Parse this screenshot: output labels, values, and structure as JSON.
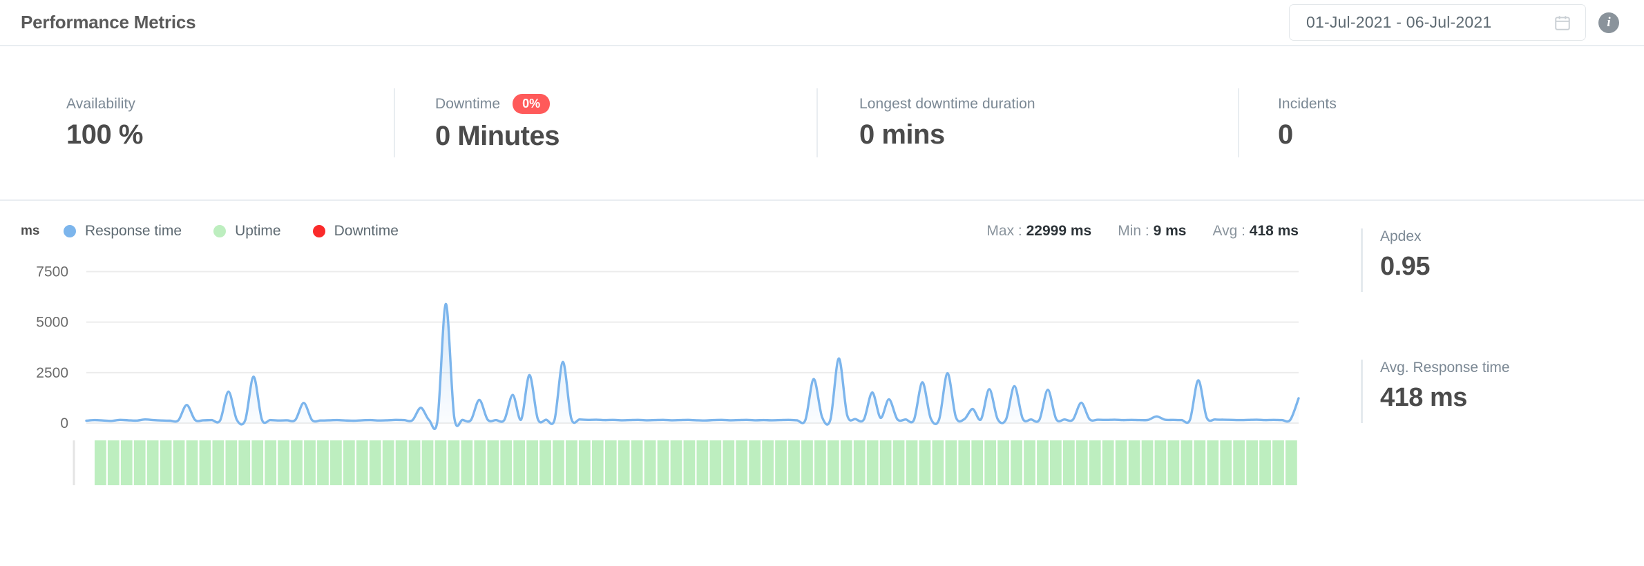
{
  "header": {
    "title": "Performance Metrics",
    "date_range": "01-Jul-2021  -  06-Jul-2021",
    "calendar_icon": "calendar-icon",
    "info_icon": "info-icon"
  },
  "kpis": [
    {
      "label": "Availability",
      "value": "100 %",
      "badge": null
    },
    {
      "label": "Downtime",
      "value": "0 Minutes",
      "badge": "0%",
      "badge_color": "#ff5a5a"
    },
    {
      "label": "Longest downtime duration",
      "value": "0 mins",
      "badge": null
    },
    {
      "label": "Incidents",
      "value": "0",
      "badge": null
    }
  ],
  "chart_header": {
    "unit": "ms",
    "legend": [
      {
        "label": "Response time",
        "color": "#7cb5ec"
      },
      {
        "label": "Uptime",
        "color": "#bdeebf"
      },
      {
        "label": "Downtime",
        "color": "#fa2a2a"
      }
    ],
    "stats": [
      {
        "label": "Max :",
        "value": "22999 ms"
      },
      {
        "label": "Min :",
        "value": "9 ms"
      },
      {
        "label": "Avg :",
        "value": "418 ms"
      }
    ]
  },
  "side_panel": [
    {
      "label": "Apdex",
      "value": "0.95"
    },
    {
      "label": "Avg. Response time",
      "value": "418 ms"
    }
  ],
  "chart_data": {
    "type": "area",
    "title": "",
    "xlabel": "",
    "ylabel": "ms",
    "ylim": [
      0,
      8200
    ],
    "yticks": [
      0,
      2500,
      5000,
      7500
    ],
    "ytick_labels": [
      "0",
      "2500",
      "5000",
      "7500"
    ],
    "grid": true,
    "legend_position": "top-left",
    "series": [
      {
        "name": "Response time",
        "color": "#7cb5ec",
        "fill": "rgba(124,181,236,0.18)",
        "values": [
          120,
          150,
          130,
          110,
          160,
          140,
          125,
          180,
          150,
          130,
          120,
          135,
          900,
          160,
          140,
          150,
          130,
          1560,
          160,
          140,
          2300,
          170,
          150,
          130,
          140,
          160,
          1000,
          150,
          130,
          140,
          150,
          130,
          120,
          140,
          150,
          130,
          140,
          160,
          150,
          140,
          760,
          150,
          140,
          5900,
          300,
          160,
          150,
          1150,
          170,
          150,
          160,
          1400,
          170,
          2380,
          200,
          170,
          160,
          3030,
          230,
          180,
          160,
          170,
          150,
          160,
          140,
          150,
          160,
          140,
          150,
          160,
          140,
          150,
          160,
          140,
          130,
          150,
          160,
          140,
          150,
          160,
          140,
          150,
          140,
          150,
          160,
          140,
          150,
          2180,
          300,
          180,
          3200,
          400,
          200,
          180,
          1520,
          260,
          1180,
          190,
          180,
          170,
          2020,
          230,
          180,
          2470,
          300,
          190,
          700,
          180,
          1680,
          200,
          180,
          1830,
          220,
          180,
          170,
          1650,
          200,
          180,
          170,
          1010,
          190,
          170,
          160,
          170,
          150,
          160,
          150,
          160,
          330,
          170,
          160,
          150,
          160,
          2120,
          280,
          180,
          170,
          160,
          150,
          160,
          170,
          150,
          160,
          150,
          160,
          1230
        ]
      },
      {
        "name": "Uptime",
        "color": "#bdeebf",
        "type": "bar-strip",
        "bars": 92,
        "all_up": true
      },
      {
        "name": "Downtime",
        "color": "#fa2a2a",
        "values": []
      }
    ],
    "annotations": {
      "max": 22999,
      "min": 9,
      "avg": 418
    }
  }
}
